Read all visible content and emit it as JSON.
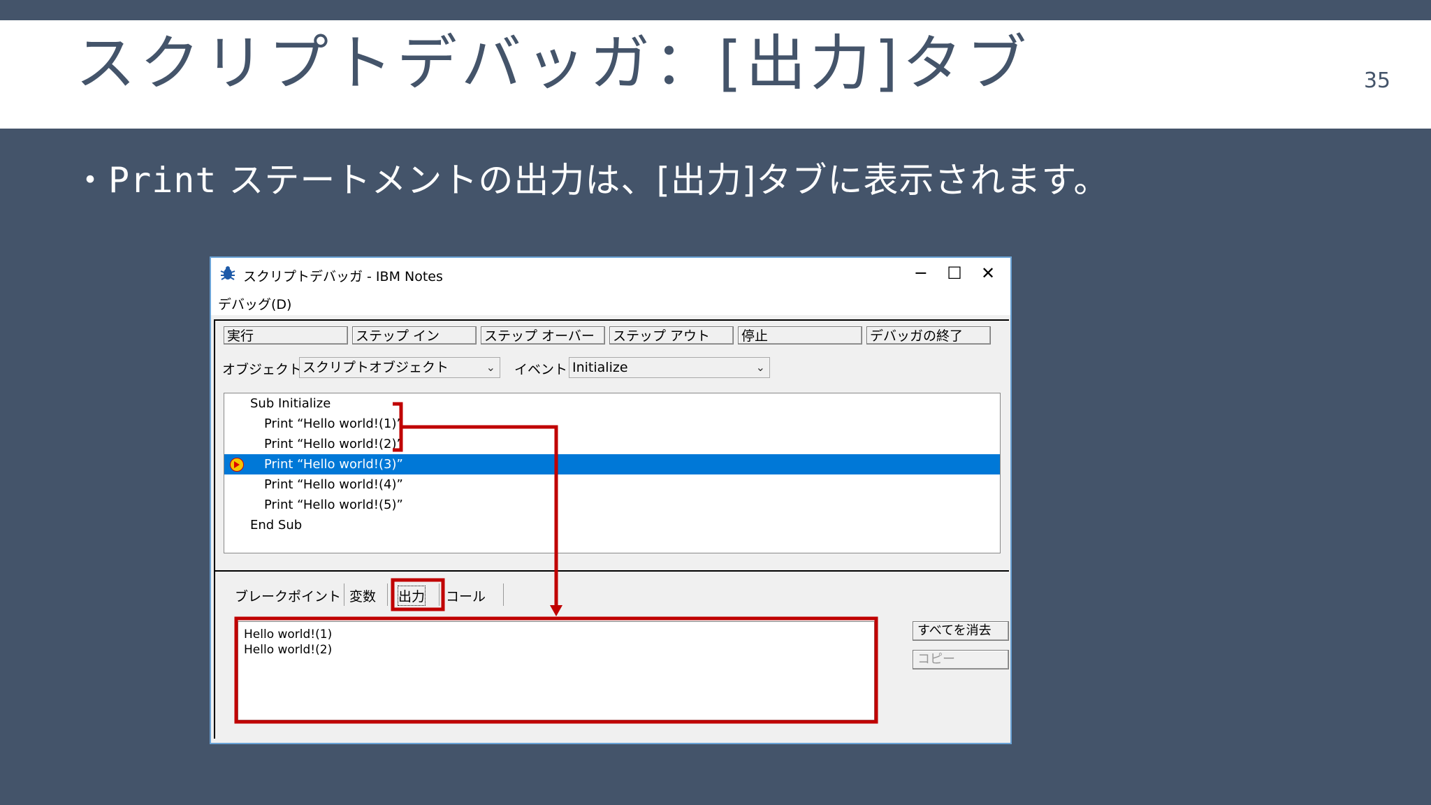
{
  "slide": {
    "title": "スクリプトデバッガ：[出力]タブ",
    "page_number": "35",
    "bullet_marker": "・",
    "bullet_code": "Print",
    "bullet_text": " ステートメントの出力は、[出力]タブに表示されます。"
  },
  "window": {
    "title": "スクリプトデバッガ - IBM Notes",
    "controls": {
      "minimize": "─",
      "maximize": "☐",
      "close": "✕"
    },
    "menu": [
      "デバッグ(D)"
    ],
    "toolbar": [
      "実行",
      "ステップ イン",
      "ステップ オーバー",
      "ステップ アウト",
      "停止",
      "デバッガの終了"
    ],
    "object_label": "オブジェクト:",
    "object_value": "スクリプトオブジェクト",
    "event_label": "イベント:",
    "event_value": "Initialize",
    "code_lines": [
      "Sub Initialize",
      "Print “Hello world!(1)”",
      "Print “Hello world!(2)”",
      "Print “Hello world!(3)”",
      "Print “Hello world!(4)”",
      "Print “Hello world!(5)”",
      "End Sub"
    ],
    "tabs": [
      "ブレークポイント",
      "変数",
      "出力",
      "コール"
    ],
    "active_tab": "出力",
    "output_lines": [
      "Hello world!(1)",
      "Hello world!(2)"
    ],
    "side_buttons": {
      "clear_all": "すべてを消去",
      "copy": "コピー"
    }
  },
  "colors": {
    "slide_bg": "#44546a",
    "selection": "#0078d7",
    "highlight": "#c00000"
  }
}
